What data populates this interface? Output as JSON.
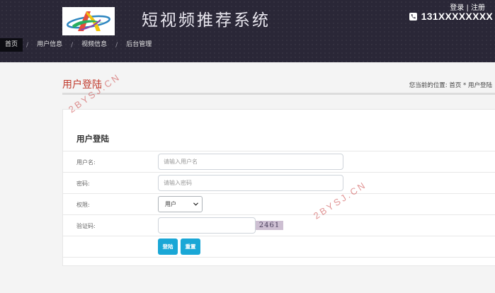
{
  "header": {
    "site_title": "短视频推荐系统",
    "login_link": "登录",
    "separator": "|",
    "register_link": "注册",
    "phone": "131XXXXXXXX"
  },
  "nav": {
    "items": [
      {
        "label": "首页",
        "active": true
      },
      {
        "label": "用户信息"
      },
      {
        "label": "视频信息"
      },
      {
        "label": "后台管理"
      }
    ],
    "separator": "/"
  },
  "page": {
    "title": "用户登陆",
    "breadcrumb": "您当前的位置:  首页 * 用户登陆"
  },
  "form": {
    "heading": "用户登陆",
    "username_label": "用户名:",
    "username_placeholder": "请输入用户名",
    "password_label": "密码:",
    "password_placeholder": "请输入密码",
    "role_label": "权限:",
    "role_value": "用户",
    "captcha_label": "验证码:",
    "captcha_value": "",
    "captcha_text": "2461",
    "login_button": "登陆",
    "reset_button": "重置"
  },
  "watermark": "2BYSJ.CN",
  "colors": {
    "header_bg": "#2a2737",
    "accent_red": "#c0392b",
    "button_blue": "#1aa7d6"
  }
}
